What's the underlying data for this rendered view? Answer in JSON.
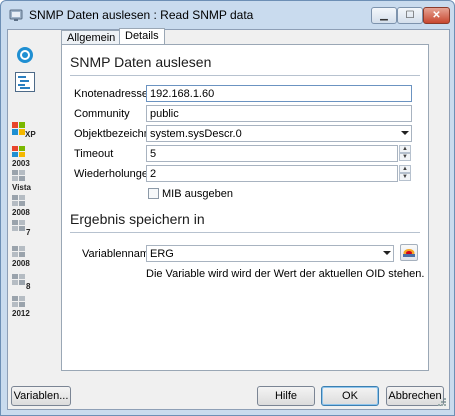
{
  "window": {
    "title": "SNMP Daten auslesen : Read SNMP data"
  },
  "tabs": [
    {
      "label": "Allgemein"
    },
    {
      "label": "Details"
    }
  ],
  "os_rail": [
    {
      "label": "XP",
      "icon": "windows-xp-icon"
    },
    {
      "label": "2003",
      "icon": "windows-2003-icon"
    },
    {
      "label": "Vista",
      "icon": "windows-vista-icon"
    },
    {
      "label": "2008",
      "icon": "windows-2008-icon"
    },
    {
      "label": "7",
      "icon": "windows-7-icon"
    },
    {
      "label": "2008",
      "icon": "windows-2008r2-icon"
    },
    {
      "label": "8",
      "icon": "windows-8-icon"
    },
    {
      "label": "2012",
      "icon": "windows-2012-icon"
    }
  ],
  "snmp": {
    "heading": "SNMP Daten auslesen",
    "node_label": "Knotenadresse",
    "node_value": "192.168.1.60",
    "community_label": "Community",
    "community_value": "public",
    "oid_label": "Objektbezeichner",
    "oid_value": "system.sysDescr.0",
    "timeout_label": "Timeout",
    "timeout_value": "5",
    "retries_label": "Wiederholungen",
    "retries_value": "2",
    "mib_label": "MIB ausgeben"
  },
  "result": {
    "heading": "Ergebnis speichern in",
    "var_label": "Variablenname",
    "var_value": "ERG",
    "hint": "Die Variable wird wird der Wert der aktuellen OID stehen."
  },
  "footer": {
    "variables_label": "Variablen...",
    "help_label": "Hilfe",
    "ok_label": "OK",
    "cancel_label": "Abbrechen"
  },
  "colors": {
    "accent": "#1f8fd2",
    "title_bg": "#c9dbee"
  }
}
